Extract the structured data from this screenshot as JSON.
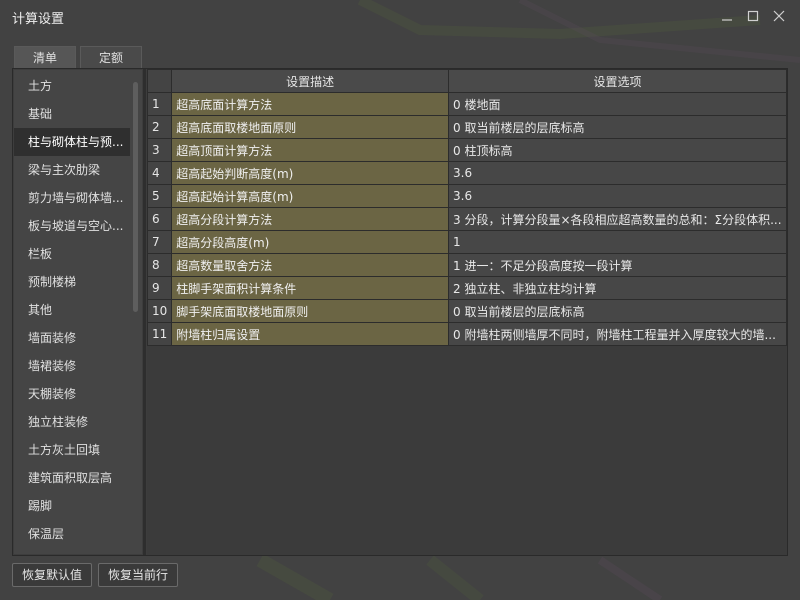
{
  "window": {
    "title": "计算设置"
  },
  "tabs": [
    {
      "label": "清单",
      "active": true
    },
    {
      "label": "定额",
      "active": false
    }
  ],
  "sidebar": {
    "items": [
      {
        "label": "土方"
      },
      {
        "label": "基础"
      },
      {
        "label": "柱与砌体柱与预...",
        "selected": true
      },
      {
        "label": "梁与主次肋梁"
      },
      {
        "label": "剪力墙与砌体墙..."
      },
      {
        "label": "板与坡道与空心..."
      },
      {
        "label": "栏板"
      },
      {
        "label": "预制楼梯"
      },
      {
        "label": "其他"
      },
      {
        "label": "墙面装修"
      },
      {
        "label": "墙裙装修"
      },
      {
        "label": "天棚装修"
      },
      {
        "label": "独立柱装修"
      },
      {
        "label": "土方灰土回填"
      },
      {
        "label": "建筑面积取层高"
      },
      {
        "label": "踢脚"
      },
      {
        "label": "保温层"
      }
    ]
  },
  "table": {
    "headers": {
      "desc": "设置描述",
      "option": "设置选项"
    },
    "rows": [
      {
        "num": "1",
        "desc": "超高底面计算方法",
        "option": "0 楼地面"
      },
      {
        "num": "2",
        "desc": "超高底面取楼地面原则",
        "option": "0 取当前楼层的层底标高"
      },
      {
        "num": "3",
        "desc": "超高顶面计算方法",
        "option": "0 柱顶标高"
      },
      {
        "num": "4",
        "desc": "超高起始判断高度(m)",
        "option": "3.6"
      },
      {
        "num": "5",
        "desc": "超高起始计算高度(m)",
        "option": "3.6"
      },
      {
        "num": "6",
        "desc": "超高分段计算方法",
        "option": "3 分段，计算分段量×各段相应超高数量的总和：Σ分段体积..."
      },
      {
        "num": "7",
        "desc": "超高分段高度(m)",
        "option": "1"
      },
      {
        "num": "8",
        "desc": "超高数量取舍方法",
        "option": "1 进一：不足分段高度按一段计算"
      },
      {
        "num": "9",
        "desc": "柱脚手架面积计算条件",
        "option": "2 独立柱、非独立柱均计算"
      },
      {
        "num": "10",
        "desc": "脚手架底面取楼地面原则",
        "option": "0 取当前楼层的层底标高"
      },
      {
        "num": "11",
        "desc": "附墙柱归属设置",
        "option": "0 附墙柱两侧墙厚不同时，附墙柱工程量并入厚度较大的墙..."
      }
    ]
  },
  "buttons": {
    "restore_default": "恢复默认值",
    "restore_current": "恢复当前行"
  },
  "colors": {
    "background": "#424242",
    "desc_cell": "#6b6544",
    "selected_item": "#2f2f2f"
  }
}
